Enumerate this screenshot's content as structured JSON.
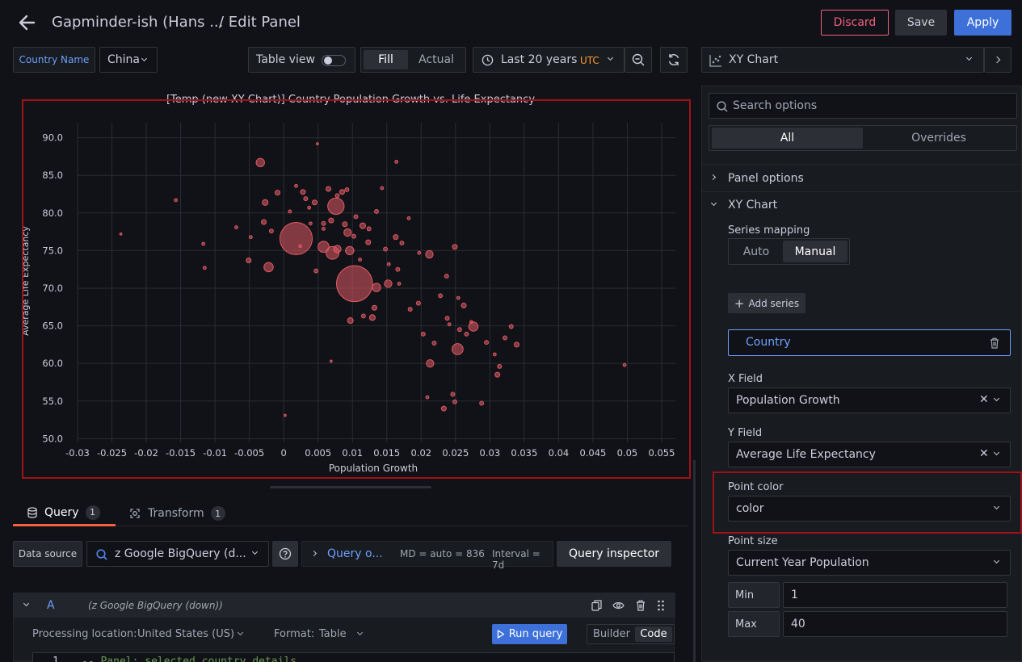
{
  "header": {
    "back_icon": "arrow-left-icon",
    "title": "Gapminder-ish (Hans ...",
    "subtitle": "/ Edit Panel",
    "discard": "Discard",
    "save": "Save",
    "apply": "Apply"
  },
  "toolbar": {
    "variable_label": "Country Name",
    "variable_value": "China",
    "table_view": "Table view",
    "fill": "Fill",
    "actual": "Actual",
    "time_range": "Last 20 years",
    "timezone": "UTC",
    "visualization": "XY Chart"
  },
  "options": {
    "search_placeholder": "Search options",
    "tab_all": "All",
    "tab_overrides": "Overrides",
    "panel_options": "Panel options",
    "xy_chart": "XY Chart",
    "series_mapping": "Series mapping",
    "auto": "Auto",
    "manual": "Manual",
    "add_series": "Add series",
    "series_name": "Country",
    "x_field_label": "X Field",
    "x_field_value": "Population Growth",
    "y_field_label": "Y Field",
    "y_field_value": "Average Life Expectancy",
    "point_color_label": "Point color",
    "point_color_value": "color",
    "point_size_label": "Point size",
    "point_size_value": "Current Year Population",
    "min_label": "Min",
    "min_value": "1",
    "max_label": "Max",
    "max_value": "40"
  },
  "query": {
    "tab_query": "Query",
    "query_count": "1",
    "tab_transform": "Transform",
    "transform_count": "1",
    "data_source_label": "Data source",
    "data_source_value": "z Google BigQuery (d...",
    "query_options": "Query o...",
    "md_info": "MD = auto = 836",
    "interval_info": "Interval = 7d",
    "query_inspector": "Query inspector",
    "row_letter": "A",
    "row_source": "(z Google BigQuery (down))",
    "processing_label": "Processing location:",
    "processing_value": "United States (US)",
    "format_label": "Format:",
    "format_value": "Table",
    "run_query": "Run query",
    "builder": "Builder",
    "code": "Code",
    "line_number": "1",
    "code_line": "-- Panel: selected country details"
  },
  "colors": {
    "accent": "#3d71d9",
    "danger": "#f0607e",
    "point": "#e05a64",
    "highlight": "#9e1218"
  },
  "chart_data": {
    "type": "scatter",
    "title": "[Temp (new XY Chart)] Country Population Growth vs. Life Expectancy",
    "xlabel": "Population Growth",
    "ylabel": "Average Life Expectancy",
    "xlim": [
      -0.03,
      0.057
    ],
    "ylim": [
      49.5,
      92
    ],
    "x_ticks": [
      "-0.03",
      "-0.025",
      "-0.02",
      "-0.015",
      "-0.01",
      "-0.005",
      "0",
      "0.005",
      "0.01",
      "0.015",
      "0.02",
      "0.025",
      "0.03",
      "0.035",
      "0.04",
      "0.045",
      "0.05",
      "0.055"
    ],
    "y_ticks": [
      "50.0",
      "55.0",
      "60.0",
      "65.0",
      "70.0",
      "75.0",
      "80.0",
      "85.0",
      "90.0"
    ],
    "grid": true,
    "points": [
      {
        "x": 0.0103,
        "y": 70.6,
        "s": 40
      },
      {
        "x": 0.0018,
        "y": 76.6,
        "s": 36
      },
      {
        "x": 0.0076,
        "y": 80.9,
        "s": 18
      },
      {
        "x": 0.0071,
        "y": 74.7,
        "s": 14
      },
      {
        "x": 0.0058,
        "y": 75.5,
        "s": 12
      },
      {
        "x": -0.0034,
        "y": 86.7,
        "s": 9
      },
      {
        "x": -0.0022,
        "y": 72.8,
        "s": 10
      },
      {
        "x": 0.0135,
        "y": 70.1,
        "s": 9
      },
      {
        "x": 0.0152,
        "y": 70.6,
        "s": 8
      },
      {
        "x": 0.0253,
        "y": 61.9,
        "s": 12
      },
      {
        "x": 0.0276,
        "y": 64.9,
        "s": 10
      },
      {
        "x": 0.0212,
        "y": 74.5,
        "s": 8
      },
      {
        "x": 0.0213,
        "y": 60.0,
        "s": 8
      },
      {
        "x": 0.0097,
        "y": 65.7,
        "s": 6
      },
      {
        "x": 0.0096,
        "y": 75.0,
        "s": 9
      },
      {
        "x": 0.0093,
        "y": 77.4,
        "s": 8
      },
      {
        "x": 0.0078,
        "y": 75.2,
        "s": 8
      },
      {
        "x": 0.0129,
        "y": 66.1,
        "s": 6
      },
      {
        "x": 0.0132,
        "y": 67.4,
        "s": 5
      },
      {
        "x": 0.0233,
        "y": 54.0,
        "s": 5
      },
      {
        "x": 0.0339,
        "y": 62.5,
        "s": 5
      },
      {
        "x": 0.0295,
        "y": 62.8,
        "s": 4
      },
      {
        "x": 0.0311,
        "y": 58.5,
        "s": 5
      },
      {
        "x": 0.0314,
        "y": 59.6,
        "s": 4
      },
      {
        "x": 0.0246,
        "y": 55.9,
        "s": 4
      },
      {
        "x": 0.0288,
        "y": 54.7,
        "s": 4
      },
      {
        "x": 0.0249,
        "y": 75.5,
        "s": 5
      },
      {
        "x": 0.0262,
        "y": 67.7,
        "s": 5
      },
      {
        "x": 0.0331,
        "y": 64.9,
        "s": 4
      },
      {
        "x": 0.0322,
        "y": 63.4,
        "s": 4
      },
      {
        "x": 0.0496,
        "y": 59.8,
        "s": 3
      },
      {
        "x": -0.0027,
        "y": 81.4,
        "s": 6
      },
      {
        "x": -0.0009,
        "y": 82.7,
        "s": 5
      },
      {
        "x": 0.0028,
        "y": 82.8,
        "s": 5
      },
      {
        "x": 0.0045,
        "y": 81.4,
        "s": 5
      },
      {
        "x": 0.0065,
        "y": 83.2,
        "s": 5
      },
      {
        "x": 0.0085,
        "y": 82.8,
        "s": 5
      },
      {
        "x": 0.0115,
        "y": 78.3,
        "s": 6
      },
      {
        "x": 0.0123,
        "y": 76.1,
        "s": 5
      },
      {
        "x": 0.0163,
        "y": 76.8,
        "s": 5
      },
      {
        "x": 0.0184,
        "y": 67.2,
        "s": 4
      },
      {
        "x": 0.0196,
        "y": 68.0,
        "s": 4
      },
      {
        "x": 0.0228,
        "y": 69.0,
        "s": 4
      },
      {
        "x": 0.0238,
        "y": 66.0,
        "s": 4
      },
      {
        "x": 0.0203,
        "y": 63.9,
        "s": 4
      },
      {
        "x": 0.0219,
        "y": 62.7,
        "s": 4
      },
      {
        "x": 0.0266,
        "y": 63.9,
        "s": 4
      },
      {
        "x": 0.0256,
        "y": 64.5,
        "s": 4
      },
      {
        "x": -0.0051,
        "y": 73.7,
        "s": 5
      },
      {
        "x": -0.0029,
        "y": 78.8,
        "s": 5
      },
      {
        "x": 0.0047,
        "y": 72.3,
        "s": 4
      },
      {
        "x": 0.0069,
        "y": 79.0,
        "s": 5
      },
      {
        "x": 0.0089,
        "y": 78.5,
        "s": 5
      },
      {
        "x": 0.0105,
        "y": 79.5,
        "s": 4
      },
      {
        "x": 0.0148,
        "y": 75.2,
        "s": 4
      },
      {
        "x": 0.0166,
        "y": 72.5,
        "s": 4
      },
      {
        "x": 0.0172,
        "y": 76.0,
        "s": 4
      },
      {
        "x": 0.0249,
        "y": 54.9,
        "s": 4
      },
      {
        "x": 0.0209,
        "y": 55.5,
        "s": 3
      },
      {
        "x": 0.0307,
        "y": 61.2,
        "s": 3
      },
      {
        "x": -0.0117,
        "y": 75.9,
        "s": 3
      },
      {
        "x": -0.0157,
        "y": 81.7,
        "s": 3
      },
      {
        "x": -0.0237,
        "y": 77.2,
        "s": 2
      },
      {
        "x": 0.0002,
        "y": 53.1,
        "s": 2
      },
      {
        "x": 0.0069,
        "y": 60.3,
        "s": 2
      },
      {
        "x": 0.0164,
        "y": 86.8,
        "s": 3
      },
      {
        "x": 0.0049,
        "y": 89.2,
        "s": 2
      },
      {
        "x": 0.0143,
        "y": 83.3,
        "s": 3
      },
      {
        "x": -0.0069,
        "y": 78.1,
        "s": 3
      },
      {
        "x": -0.0115,
        "y": 72.7,
        "s": 3
      },
      {
        "x": 0.0039,
        "y": 78.6,
        "s": 3
      },
      {
        "x": 0.0024,
        "y": 75.6,
        "s": 3
      },
      {
        "x": 0.0058,
        "y": 77.9,
        "s": 3
      },
      {
        "x": 0.0037,
        "y": 80.7,
        "s": 3
      },
      {
        "x": 0.0182,
        "y": 79.3,
        "s": 3
      },
      {
        "x": 0.0111,
        "y": 73.8,
        "s": 3
      },
      {
        "x": 0.0018,
        "y": 83.6,
        "s": 3
      },
      {
        "x": -0.0048,
        "y": 76.8,
        "s": 3
      },
      {
        "x": 0.0009,
        "y": 80.2,
        "s": 3
      },
      {
        "x": 0.0153,
        "y": 73.2,
        "s": 3
      },
      {
        "x": 0.0168,
        "y": 70.6,
        "s": 3
      },
      {
        "x": 0.0241,
        "y": 65.2,
        "s": 3
      },
      {
        "x": 0.0273,
        "y": 65.5,
        "s": 3
      },
      {
        "x": 0.0197,
        "y": 74.7,
        "s": 3
      },
      {
        "x": 0.0254,
        "y": 68.7,
        "s": 3
      },
      {
        "x": 0.0032,
        "y": 81.9,
        "s": 4
      },
      {
        "x": 0.0078,
        "y": 82.3,
        "s": 4
      },
      {
        "x": 0.0092,
        "y": 83.1,
        "s": 4
      },
      {
        "x": 0.0102,
        "y": 76.9,
        "s": 4
      },
      {
        "x": 0.0124,
        "y": 77.9,
        "s": 4
      },
      {
        "x": 0.0135,
        "y": 80.2,
        "s": 4
      },
      {
        "x": -0.0018,
        "y": 77.6,
        "s": 4
      },
      {
        "x": 0.0058,
        "y": 78.6,
        "s": 4
      },
      {
        "x": 0.0116,
        "y": 66.3,
        "s": 4
      },
      {
        "x": 0.0237,
        "y": 71.6,
        "s": 4
      }
    ]
  }
}
